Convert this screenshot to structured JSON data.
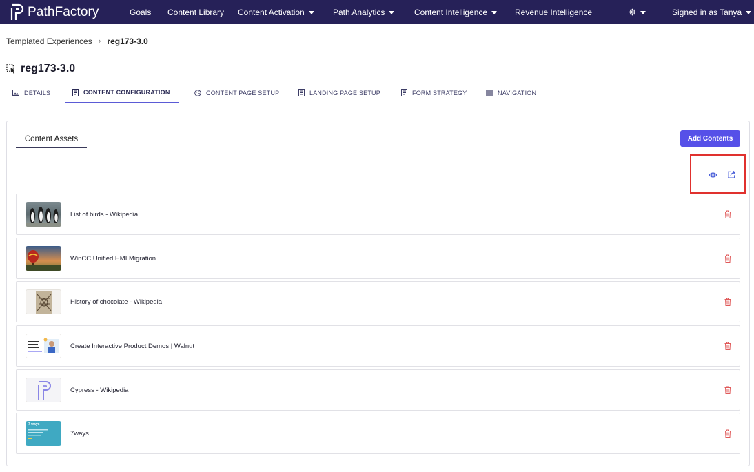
{
  "brand": {
    "name": "PathFactory"
  },
  "nav": {
    "goals": "Goals",
    "content_library": "Content Library",
    "content_activation": "Content Activation",
    "path_analytics": "Path Analytics",
    "content_intelligence": "Content Intelligence",
    "revenue_intelligence": "Revenue Intelligence",
    "user": "Signed in as Tanya"
  },
  "breadcrumb": {
    "parent": "Templated Experiences",
    "current": "reg173-3.0"
  },
  "page": {
    "title": "reg173-3.0"
  },
  "tabs": [
    {
      "label": "DETAILS",
      "icon": "image-icon"
    },
    {
      "label": "CONTENT CONFIGURATION",
      "icon": "document-icon"
    },
    {
      "label": "CONTENT PAGE SETUP",
      "icon": "palette-icon"
    },
    {
      "label": "LANDING PAGE SETUP",
      "icon": "page-icon"
    },
    {
      "label": "FORM STRATEGY",
      "icon": "form-icon"
    },
    {
      "label": "NAVIGATION",
      "icon": "list-icon"
    }
  ],
  "panel": {
    "subtab": "Content Assets",
    "add_button": "Add Contents"
  },
  "assets": [
    {
      "title": "List of birds - Wikipedia",
      "thumb": "penguins"
    },
    {
      "title": "WinCC Unified HMI Migration",
      "thumb": "balloon"
    },
    {
      "title": "History of chocolate - Wikipedia",
      "thumb": "manuscript"
    },
    {
      "title": "Create Interactive Product Demos | Walnut",
      "thumb": "walnut"
    },
    {
      "title": "Cypress - Wikipedia",
      "thumb": "pathfactory-logo"
    },
    {
      "title": "7ways",
      "thumb": "teal-slide",
      "thumb_text": "7 ways"
    }
  ],
  "colors": {
    "nav_bg": "#262158",
    "accent": "#5650e8",
    "delete": "#e05a5a",
    "highlight": "#e0312e"
  }
}
